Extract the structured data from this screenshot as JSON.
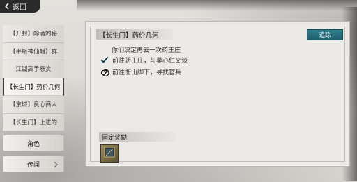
{
  "back_button": {
    "label": "返回"
  },
  "quest_list": {
    "items": [
      {
        "label": "【开封】醇酒的秘",
        "active": false
      },
      {
        "label": "【半瓶神仙醋】群",
        "active": false
      },
      {
        "label": "江湖高手悬赏",
        "active": false
      },
      {
        "label": "【长生门】药价几何",
        "active": true
      },
      {
        "label": "【京城】良心商人",
        "active": false
      },
      {
        "label": "【长生门】上进的",
        "active": false
      }
    ]
  },
  "bottom_tabs": [
    {
      "label": "角色"
    },
    {
      "label": "传闻"
    }
  ],
  "quest_detail": {
    "title": "【长生门】药价几何",
    "track_label": "追踪",
    "description": "你们决定再去一次药王庄",
    "objectives": [
      {
        "text": "前往药王庄，与莫心仁交谈",
        "status": "completed",
        "icon": "check-icon"
      },
      {
        "text": "前往衡山脚下，寻找官兵",
        "status": "in-progress",
        "icon": "spiral-icon"
      }
    ]
  },
  "rewards": {
    "title": "固定奖励",
    "items": [
      {
        "icon": "book-icon"
      }
    ]
  },
  "colors": {
    "track_button": "#2f7f8d",
    "panel_bg": "#ebeae6",
    "ink": "#2a2a2a"
  }
}
